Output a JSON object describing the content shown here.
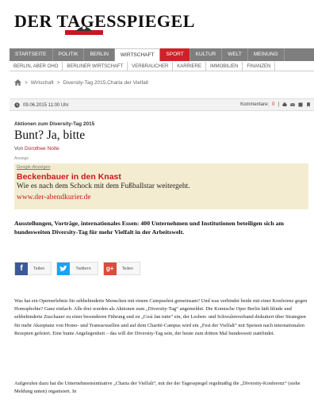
{
  "site": {
    "logo_text": "DER TAGESSPIEGEL"
  },
  "nav": {
    "items": [
      "STARTSEITE",
      "POLITIK",
      "BERLIN",
      "WIRTSCHAFT",
      "SPORT",
      "KULTUR",
      "WELT",
      "MEINUNG"
    ],
    "active": "WIRTSCHAFT"
  },
  "subnav": {
    "items": [
      "BERLIN, ABER OHO",
      "BERLINER WIRTSCHAFT",
      "VERBRAUCHER",
      "KARRIERE",
      "IMMOBILIEN",
      "FINANZEN"
    ]
  },
  "breadcrumb": {
    "sep": ">",
    "section": "Wirtschaft",
    "current": "Diversity-Tag 2015,Charta der Vielfalt"
  },
  "meta": {
    "date": "09.06.2015 11:00 Uhr",
    "comments_label": "Kommentare:",
    "comments_count": "0",
    "sep": "|"
  },
  "article": {
    "kicker": "Aktionen zum Diversity-Tag 2015",
    "title": "Bunt? Ja, bitte",
    "author_prefix": "Von",
    "author": "Dorothee Nolte",
    "anzeige": "Anzeige",
    "lead": "Ausstellungen, Vorträge, internationales Essen: 400 Unternehmen und Institutionen beteiligen sich am bundesweiten Diversity-Tag für mehr Vielfalt in der Arbeitswelt.",
    "p1": "Was hat ein Opernerlebnis für sehbehinderte Menschen mit einem Campusfest gemeinsam? Und was verbindet beide mit einer Konferenz gegen Homophobie? Ganz einfach: Alle drei wurden als Aktionen zum „Diversity-Tag“ angemeldet. Die Komische Oper Berlin lädt blinde und sehbehinderte Zuschauer zu einer besonderen Führung und zu „Così fan tutte“ ein, der Lesben- und Schwulenverband diskutiert über Strategien für mehr Akzeptanz von Homo- und Transsexuellen und auf dem Charité-Campus wird ein „Fest der Vielfalt“ mit Speisen nach internationalen Rezepten gefeiert. Eine bunte Angelegenheit – das will der Diversity-Tag sein, der heute zum dritten Mal bundesweit stattfindet.",
    "p2": "Aufgerufen dazu hat die Unternehmensinitiative „Charta der Vielfalt“, mit der der Tagesspiegel regelmäßig die „Diversity-Konferenz“ (siehe Meldung unten) organisiert. In"
  },
  "ad": {
    "label": "Google-Anzeigen",
    "title": "Beckenbauer in den Knast",
    "text": "Wie es nach dem Schock mit dem Fußballstar weitergeht.",
    "url": "www.der-abendkurier.de"
  },
  "share": {
    "facebook_label": "Teilen",
    "twitter_label": "Twittern",
    "google_label": "Teilen",
    "facebook_glyph": "f",
    "google_glyph": "g+"
  },
  "colors": {
    "nav_bg": "#7e7e7e",
    "sport": "#d0202a",
    "accent": "#c8171f",
    "ad_bg": "#f4ecd0"
  }
}
